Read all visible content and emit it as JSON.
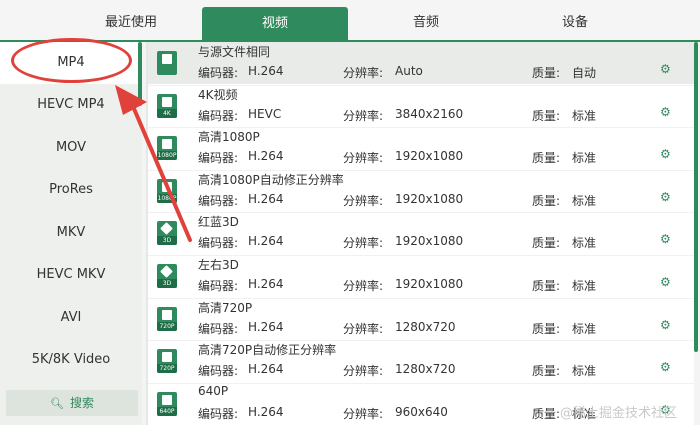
{
  "tabs": [
    {
      "label": "最近使用",
      "active": false
    },
    {
      "label": "视频",
      "active": true
    },
    {
      "label": "音频",
      "active": false
    },
    {
      "label": "设备",
      "active": false
    }
  ],
  "sidebar": {
    "items": [
      "MP4",
      "HEVC MP4",
      "MOV",
      "ProRes",
      "MKV",
      "HEVC MKV",
      "AVI",
      "5K/8K Video"
    ],
    "selected": "MP4",
    "search_label": "搜索"
  },
  "labels": {
    "encoder": "编码器:",
    "resolution": "分辨率:",
    "quality": "质量:"
  },
  "presets": [
    {
      "title": "与源文件相同",
      "encoder": "H.264",
      "resolution": "Auto",
      "quality": "自动",
      "icon": "same-as-source-icon",
      "tag": ""
    },
    {
      "title": "4K视频",
      "encoder": "HEVC",
      "resolution": "3840x2160",
      "quality": "标准",
      "icon": "4k-video-icon",
      "tag": "4K"
    },
    {
      "title": "高清1080P",
      "encoder": "H.264",
      "resolution": "1920x1080",
      "quality": "标准",
      "icon": "hd-1080p-icon",
      "tag": "1080P"
    },
    {
      "title": "高清1080P自动修正分辨率",
      "encoder": "H.264",
      "resolution": "1920x1080",
      "quality": "标准",
      "icon": "hd-1080p-icon",
      "tag": "1080P"
    },
    {
      "title": "红蓝3D",
      "encoder": "H.264",
      "resolution": "1920x1080",
      "quality": "标准",
      "icon": "3d-cube-icon",
      "tag": "3D"
    },
    {
      "title": "左右3D",
      "encoder": "H.264",
      "resolution": "1920x1080",
      "quality": "标准",
      "icon": "3d-cube-icon",
      "tag": "3D"
    },
    {
      "title": "高清720P",
      "encoder": "H.264",
      "resolution": "1280x720",
      "quality": "标准",
      "icon": "hd-720p-icon",
      "tag": "720P"
    },
    {
      "title": "高清720P自动修正分辨率",
      "encoder": "H.264",
      "resolution": "1280x720",
      "quality": "标准",
      "icon": "hd-720p-icon",
      "tag": "720P"
    },
    {
      "title": "640P",
      "encoder": "H.264",
      "resolution": "960x640",
      "quality": "标准",
      "icon": "640p-icon",
      "tag": "640P"
    }
  ],
  "watermark": "@稀土掘金技术社区",
  "colors": {
    "accent": "#2f8a5d",
    "annotation": "#e0413a"
  }
}
